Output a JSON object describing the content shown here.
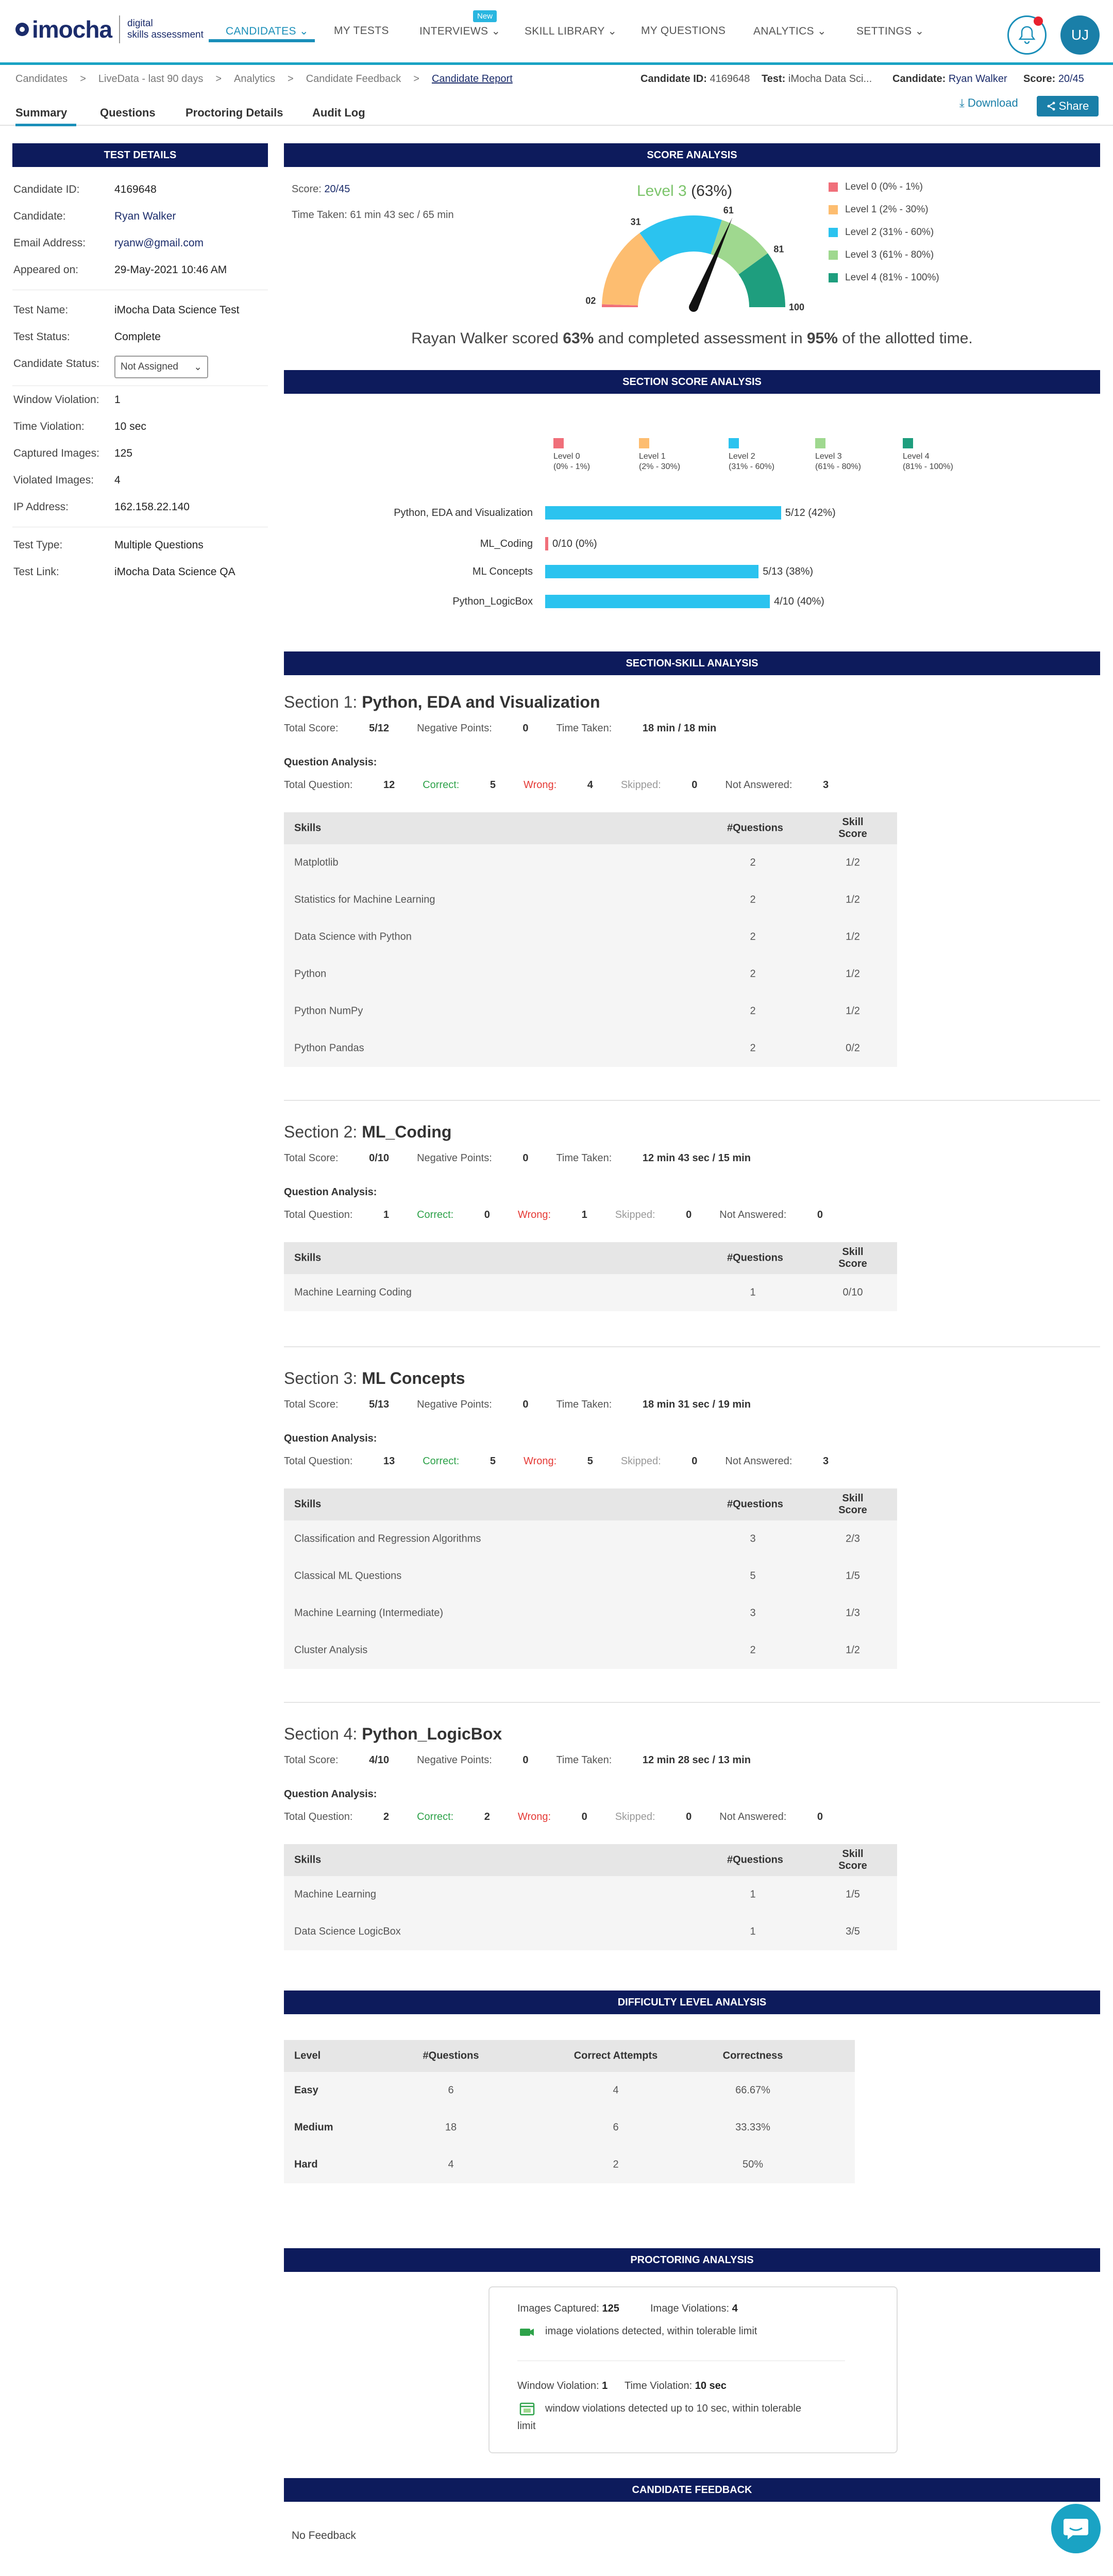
{
  "brand": {
    "name": "imocha",
    "tagline_1": "digital",
    "tagline_2": "skills assessment"
  },
  "nav": {
    "items": [
      "CANDIDATES",
      "MY TESTS",
      "INTERVIEWS",
      "SKILL LIBRARY",
      "MY QUESTIONS",
      "ANALYTICS",
      "SETTINGS"
    ],
    "new_badge": "New",
    "avatar_initials": "UJ"
  },
  "breadcrumb": [
    "Candidates",
    ">",
    "LiveData - last 90 days",
    ">",
    "Analytics",
    ">",
    "Candidate Feedback",
    ">",
    "Candidate Report"
  ],
  "meta": {
    "candidate_id_label": "Candidate ID:",
    "candidate_id": "4169648",
    "test_label": "Test:",
    "test": "iMocha Data Sci...",
    "candidate_label": "Candidate:",
    "candidate": "Ryan Walker",
    "score_label": "Score:",
    "score": "20/45"
  },
  "tabs": [
    "Summary",
    "Questions",
    "Proctoring Details",
    "Audit Log"
  ],
  "actions": {
    "download": "Download",
    "share": "Share"
  },
  "test_details": {
    "title": "TEST DETAILS",
    "rows": [
      {
        "label": "Candidate ID:",
        "value": "4169648"
      },
      {
        "label": "Candidate:",
        "value": "Ryan Walker"
      },
      {
        "label": "Email Address:",
        "value": "ryanw@gmail.com"
      },
      {
        "label": "Appeared on:",
        "value": "29-May-2021 10:46 AM"
      },
      {
        "label": "Test Name:",
        "value": "iMocha Data Science Test"
      },
      {
        "label": "Test Status:",
        "value": "Complete"
      },
      {
        "label": "Candidate Status:",
        "value": "Not Assigned"
      },
      {
        "label": "Window Violation:",
        "value": "1"
      },
      {
        "label": "Time Violation:",
        "value": "10 sec"
      },
      {
        "label": "Captured Images:",
        "value": "125"
      },
      {
        "label": "Violated Images:",
        "value": "4"
      },
      {
        "label": "IP Address:",
        "value": "162.158.22.140"
      },
      {
        "label": "Test Type:",
        "value": "Multiple Questions"
      },
      {
        "label": "Test Link:",
        "value": "iMocha Data Science QA"
      }
    ]
  },
  "score_analysis": {
    "title": "SCORE ANALYSIS",
    "score_label": "Score:",
    "score": "20/45",
    "time_taken": "Time Taken: 61 min 43 sec / 65 min",
    "level_text": "Level 3",
    "level_pct": "(63%)",
    "gauge_value": 63,
    "gauge_ticks": [
      "02",
      "31",
      "61",
      "81",
      "100"
    ],
    "legend": [
      {
        "label": "Level 0 (0% - 1%)",
        "color": "#f06f7a"
      },
      {
        "label": "Level 1 (2% - 30%)",
        "color": "#fdbd70"
      },
      {
        "label": "Level 2 (31% - 60%)",
        "color": "#2bc3ef"
      },
      {
        "label": "Level 3 (61% - 80%)",
        "color": "#9fd88f"
      },
      {
        "label": "Level 4 (81% - 100%)",
        "color": "#1e9e7e"
      }
    ],
    "summary_1": "Rayan Walker scored ",
    "summary_2": "63%",
    "summary_3": " and completed assessment in ",
    "summary_4": "95%",
    "summary_5": " of the allotted time."
  },
  "section_score": {
    "title": "SECTION SCORE ANALYSIS",
    "legend": [
      {
        "l1": "Level 0",
        "l2": "(0% - 1%)",
        "color": "#f06f7a"
      },
      {
        "l1": "Level 1",
        "l2": "(2% - 30%)",
        "color": "#fdbd70"
      },
      {
        "l1": "Level 2",
        "l2": "(31% - 60%)",
        "color": "#2bc3ef"
      },
      {
        "l1": "Level 3",
        "l2": "(61% - 80%)",
        "color": "#9fd88f"
      },
      {
        "l1": "Level 4",
        "l2": "(81% - 100%)",
        "color": "#1e9e7e"
      }
    ],
    "chart_data": {
      "type": "bar",
      "categories": [
        "Python, EDA and Visualization",
        "ML_Coding",
        "ML Concepts",
        "Python_LogicBox"
      ],
      "values": [
        42,
        0,
        38,
        40
      ],
      "labels": [
        "5/12 (42%)",
        "0/10 (0%)",
        "5/13 (38%)",
        "4/10 (40%)"
      ],
      "xlim": [
        0,
        100
      ]
    }
  },
  "skill_analysis": {
    "title": "SECTION-SKILL ANALYSIS",
    "labels": {
      "total_score": "Total Score:",
      "negative": "Negative Points:",
      "time": "Time Taken:",
      "qa": "Question Analysis:",
      "total_q": "Total Question:",
      "correct": "Correct:",
      "wrong": "Wrong:",
      "skipped": "Skipped:",
      "not_answered": "Not Answered:",
      "skills": "Skills",
      "questions": "#Questions",
      "skill_score": "Skill Score"
    },
    "sections": [
      {
        "prefix": "Section 1: ",
        "name": "Python, EDA and Visualization",
        "total_score": "5/12",
        "negative": "0",
        "time": "18 min / 18 min",
        "total_q": "12",
        "correct": "5",
        "wrong": "4",
        "skipped": "0",
        "not_answered": "3",
        "skills": [
          [
            "Matplotlib",
            "2",
            "1/2"
          ],
          [
            "Statistics for Machine Learning",
            "2",
            "1/2"
          ],
          [
            "Data Science with Python",
            "2",
            "1/2"
          ],
          [
            "Python",
            "2",
            "1/2"
          ],
          [
            "Python NumPy",
            "2",
            "1/2"
          ],
          [
            "Python Pandas",
            "2",
            "0/2"
          ]
        ]
      },
      {
        "prefix": "Section 2: ",
        "name": "ML_Coding",
        "total_score": "0/10",
        "negative": "0",
        "time": "12 min 43 sec / 15 min",
        "total_q": "1",
        "correct": "0",
        "wrong": "1",
        "skipped": "0",
        "not_answered": "0",
        "skills": [
          [
            "Machine Learning Coding",
            "1",
            "0/10"
          ]
        ]
      },
      {
        "prefix": "Section 3: ",
        "name": "ML Concepts",
        "total_score": "5/13",
        "negative": "0",
        "time": "18 min 31 sec / 19 min",
        "total_q": "13",
        "correct": "5",
        "wrong": "5",
        "skipped": "0",
        "not_answered": "3",
        "skills": [
          [
            "Classification and Regression Algorithms",
            "3",
            "2/3"
          ],
          [
            "Classical ML Questions",
            "5",
            "1/5"
          ],
          [
            "Machine Learning (Intermediate)",
            "3",
            "1/3"
          ],
          [
            "Cluster Analysis",
            "2",
            "1/2"
          ]
        ]
      },
      {
        "prefix": "Section 4: ",
        "name": "Python_LogicBox",
        "total_score": "4/10",
        "negative": "0",
        "time": "12 min 28 sec / 13 min",
        "total_q": "2",
        "correct": "2",
        "wrong": "0",
        "skipped": "0",
        "not_answered": "0",
        "skills": [
          [
            "Machine Learning",
            "1",
            "1/5"
          ],
          [
            "Data Science LogicBox",
            "1",
            "3/5"
          ]
        ]
      }
    ]
  },
  "difficulty": {
    "title": "DIFFICULTY LEVEL ANALYSIS",
    "headers": [
      "Level",
      "#Questions",
      "Correct Attempts",
      "Correctness"
    ],
    "rows": [
      [
        "Easy",
        "6",
        "4",
        "66.67%"
      ],
      [
        "Medium",
        "18",
        "6",
        "33.33%"
      ],
      [
        "Hard",
        "4",
        "2",
        "50%"
      ]
    ]
  },
  "proctoring": {
    "title": "PROCTORING ANALYSIS",
    "images_captured_label": "Images Captured:",
    "images_captured": "125",
    "image_violations_label": "Image Violations:",
    "image_violations": "4",
    "image_note": "image violations detected, within tolerable limit",
    "window_violation_label": "Window Violation:",
    "window_violation": "1",
    "time_violation_label": "Time Violation:",
    "time_violation": "10 sec",
    "window_note_1": "window violations detected up to 10 sec, within tolerable",
    "window_note_2": "limit"
  },
  "feedback": {
    "title": "CANDIDATE FEEDBACK",
    "text": "No Feedback"
  }
}
